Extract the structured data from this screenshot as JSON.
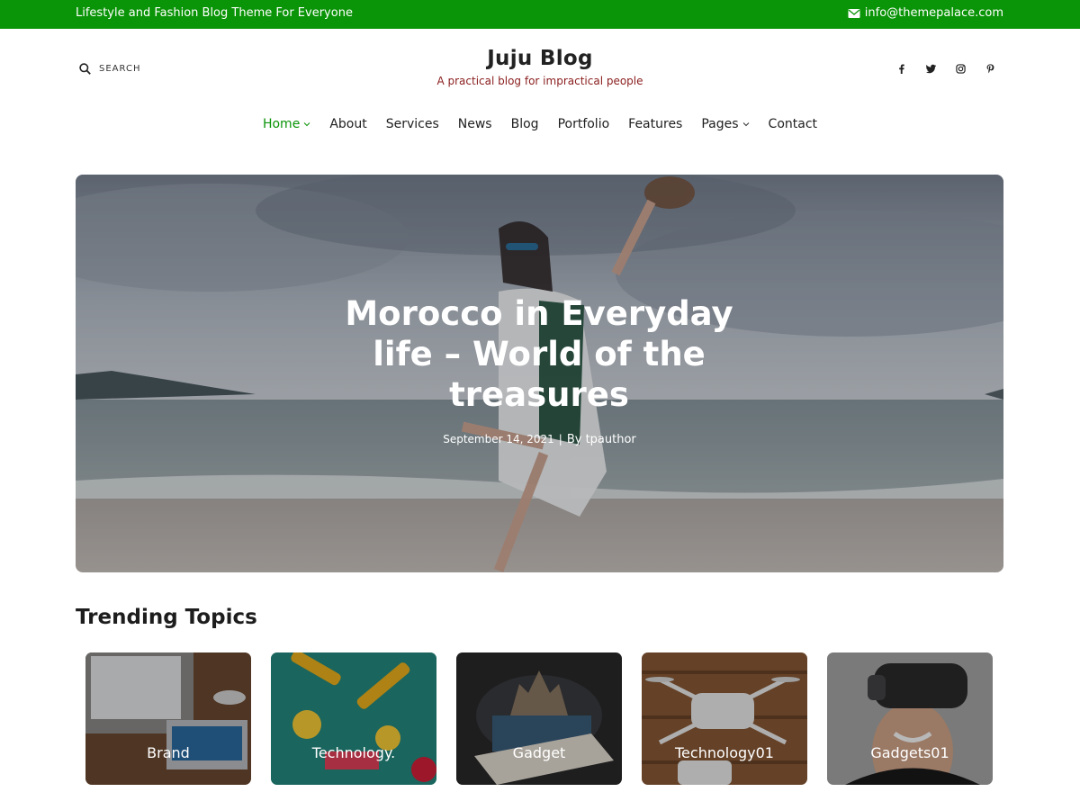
{
  "topbar": {
    "tagline": "Lifestyle and Fashion Blog Theme For Everyone",
    "email": "info@themepalace.com",
    "background": "#0a9407"
  },
  "header": {
    "search_label": "SEARCH",
    "site_title": "Juju Blog",
    "site_description": "A practical blog for impractical people",
    "social": [
      "facebook-icon",
      "twitter-icon",
      "instagram-icon",
      "pinterest-icon"
    ]
  },
  "nav": {
    "items": [
      {
        "label": "Home",
        "dropdown": true,
        "active": true
      },
      {
        "label": "About"
      },
      {
        "label": "Services"
      },
      {
        "label": "News"
      },
      {
        "label": "Blog"
      },
      {
        "label": "Portfolio"
      },
      {
        "label": "Features"
      },
      {
        "label": "Pages",
        "dropdown": true
      },
      {
        "label": "Contact"
      }
    ],
    "active_color": "#0a9407"
  },
  "hero": {
    "title": "Morocco in Everyday life – World of the treasures",
    "date": "September 14, 2021",
    "separator": "|",
    "author": "By tpauthor"
  },
  "trending": {
    "heading": "Trending Topics",
    "cards": [
      {
        "label": "Brand"
      },
      {
        "label": "Technology."
      },
      {
        "label": "Gadget"
      },
      {
        "label": "Technology01"
      },
      {
        "label": "Gadgets01"
      }
    ]
  }
}
